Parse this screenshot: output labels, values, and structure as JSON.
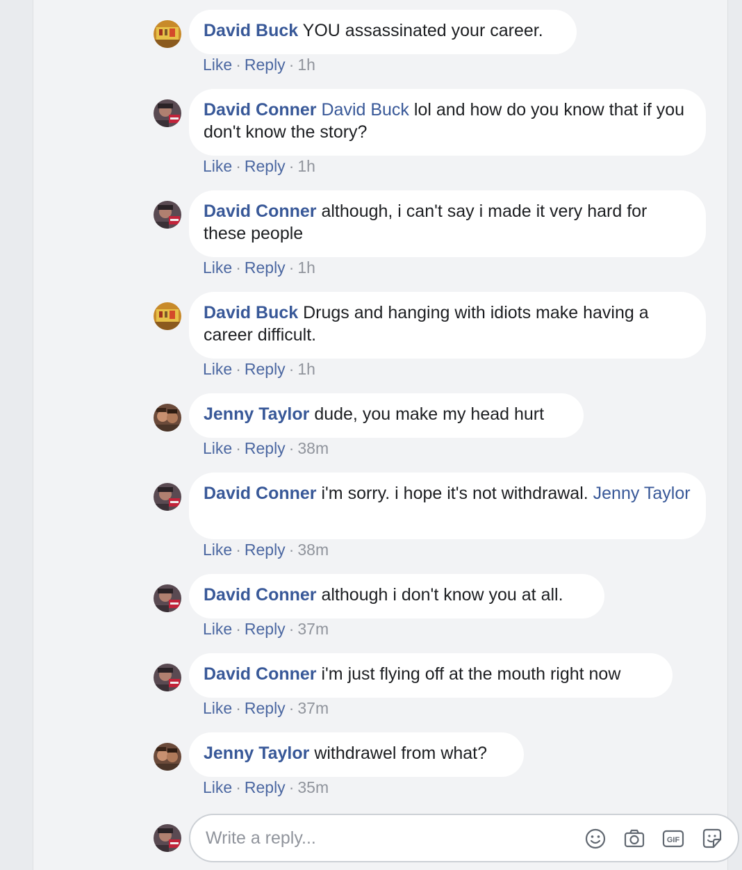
{
  "comments": [
    {
      "author": "David Buck",
      "mention": "",
      "text": " YOU assassinated your career.",
      "mention_after": "",
      "like": "Like",
      "reply": "Reply",
      "time": "1h",
      "avatar": "avatar-yellow"
    },
    {
      "author": "David Conner",
      "mention": "David Buck",
      "text": " lol and how do you know that if you don't know the story?",
      "mention_after": "",
      "like": "Like",
      "reply": "Reply",
      "time": "1h",
      "avatar": "avatar-dark"
    },
    {
      "author": "David Conner",
      "mention": "",
      "text": " although, i can't say i made it very hard for these people",
      "mention_after": "",
      "like": "Like",
      "reply": "Reply",
      "time": "1h",
      "avatar": "avatar-dark"
    },
    {
      "author": "David Buck",
      "mention": "",
      "text": " Drugs and hanging with idiots make having a career difficult.",
      "mention_after": "",
      "like": "Like",
      "reply": "Reply",
      "time": "1h",
      "avatar": "avatar-yellow"
    },
    {
      "author": "Jenny Taylor",
      "mention": "",
      "text": " dude, you make my head hurt",
      "mention_after": "",
      "like": "Like",
      "reply": "Reply",
      "time": "38m",
      "avatar": "avatar-brown"
    },
    {
      "author": "David Conner",
      "mention": "",
      "text": " i'm sorry. i hope it's not withdrawal.",
      "mention_after": "Jenny Taylor",
      "like": "Like",
      "reply": "Reply",
      "time": "38m",
      "avatar": "avatar-dark"
    },
    {
      "author": "David Conner",
      "mention": "",
      "text": " although i don't know you at all.",
      "mention_after": "",
      "like": "Like",
      "reply": "Reply",
      "time": "37m",
      "avatar": "avatar-dark"
    },
    {
      "author": "David Conner",
      "mention": "",
      "text": " i'm just flying off at the mouth right now",
      "mention_after": "",
      "like": "Like",
      "reply": "Reply",
      "time": "37m",
      "avatar": "avatar-dark"
    },
    {
      "author": "Jenny Taylor",
      "mention": "",
      "text": " withdrawel from what?",
      "mention_after": "",
      "like": "Like",
      "reply": "Reply",
      "time": "35m",
      "avatar": "avatar-brown"
    }
  ],
  "reply_box": {
    "placeholder": "Write a reply...",
    "tools": [
      "emoji-icon",
      "camera-icon",
      "gif-icon",
      "sticker-icon"
    ],
    "gif_label": "GIF"
  },
  "colors": {
    "link": "#385898",
    "meta": "#90949c",
    "bubble": "#ffffff",
    "panel": "#f2f3f5"
  }
}
